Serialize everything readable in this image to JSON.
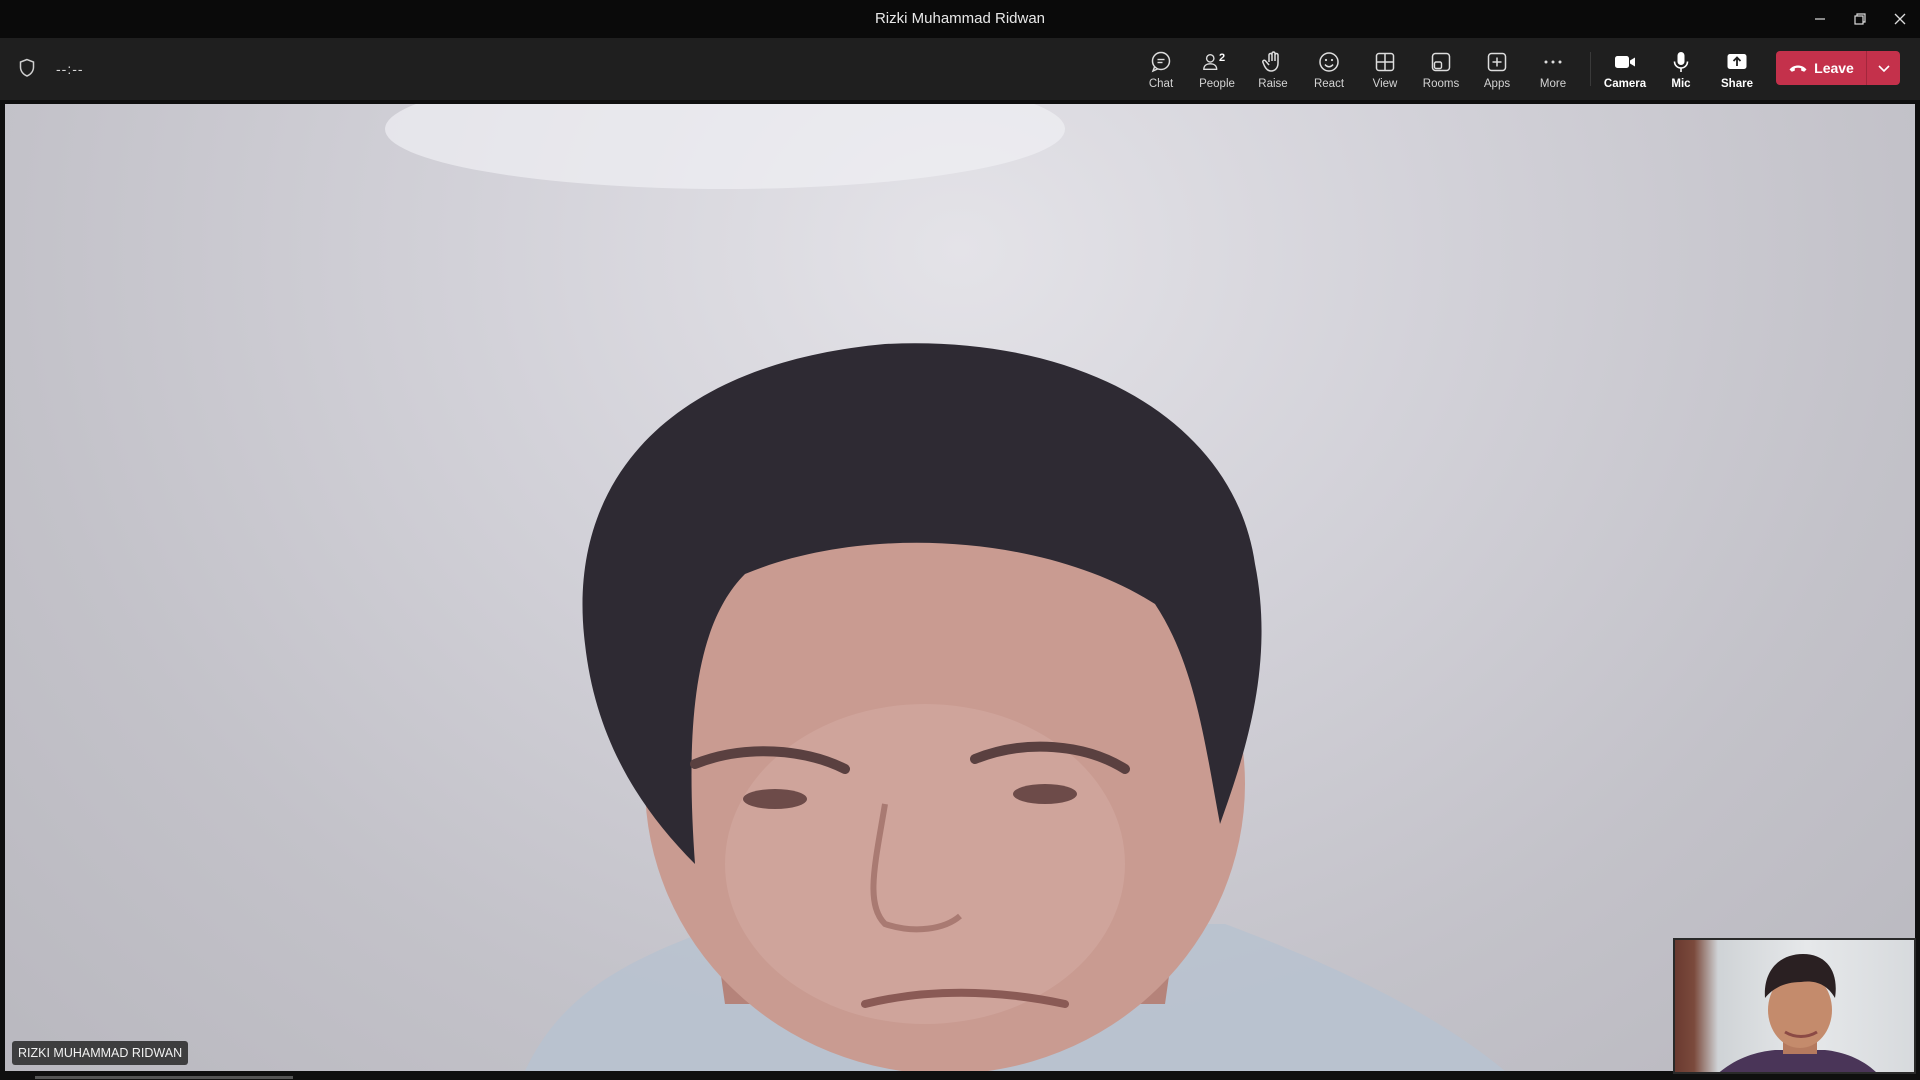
{
  "window": {
    "title": "Rizki Muhammad Ridwan"
  },
  "toolbar": {
    "timer": "--:--",
    "buttons": {
      "chat": "Chat",
      "people": "People",
      "people_count": "2",
      "raise": "Raise",
      "react": "React",
      "view": "View",
      "rooms": "Rooms",
      "apps": "Apps",
      "more": "More",
      "camera": "Camera",
      "mic": "Mic",
      "share": "Share",
      "leave": "Leave"
    },
    "icons": [
      "shield-icon",
      "chat-icon",
      "people-icon",
      "hand-icon",
      "smile-icon",
      "grid-icon",
      "rooms-icon",
      "apps-icon",
      "more-icon",
      "camera-icon",
      "mic-icon",
      "share-icon",
      "phone-icon",
      "chevron-down-icon"
    ]
  },
  "video": {
    "participant_name": "RIZKI MUHAMMAD RIDWAN"
  },
  "colors": {
    "leave_button": "#c4314b",
    "toolbar_bg": "#1f1f1f",
    "titlebar_bg": "#0a0a0a"
  }
}
